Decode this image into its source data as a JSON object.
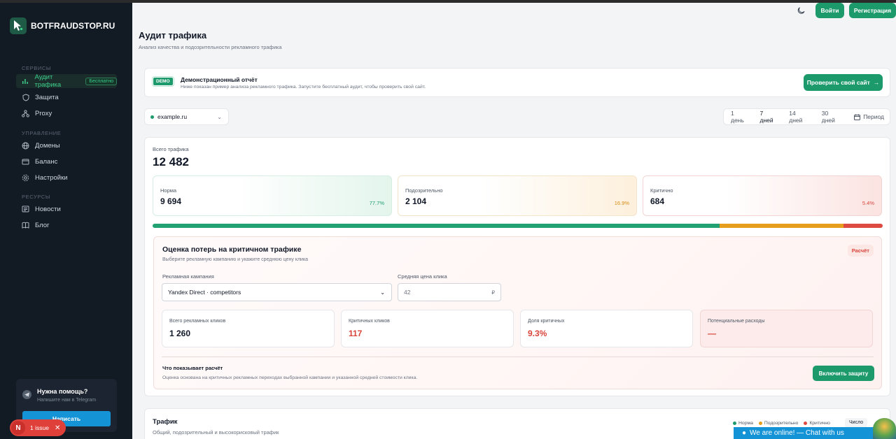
{
  "brand": {
    "name": "BOTFRAUDSTOP.RU"
  },
  "sidebar": {
    "sections": [
      {
        "label": "СЕРВИСЫ"
      },
      {
        "label": "УПРАВЛЕНИЕ"
      },
      {
        "label": "РЕСУРСЫ"
      }
    ],
    "items": [
      {
        "label": "Аудит трафика",
        "badge": "Бесплатно",
        "icon": "chart-bars-icon"
      },
      {
        "label": "Защита",
        "icon": "shield-icon"
      },
      {
        "label": "Proxy",
        "icon": "network-icon"
      },
      {
        "label": "Домены",
        "icon": "globe-icon"
      },
      {
        "label": "Баланс",
        "icon": "wallet-icon"
      },
      {
        "label": "Настройки",
        "icon": "gear-icon"
      },
      {
        "label": "Новости",
        "icon": "newspaper-icon"
      },
      {
        "label": "Блог",
        "icon": "book-icon"
      }
    ],
    "help": {
      "title": "Нужна помощь?",
      "subtitle": "Напишите нам в Telegram",
      "button": "Написать"
    }
  },
  "issues": {
    "letter": "N",
    "label": "1 issue"
  },
  "header": {
    "login": "Войти",
    "register": "Регистрация"
  },
  "page": {
    "title": "Аудит трафика",
    "subtitle": "Анализ качества и подозрительности рекламного трафика"
  },
  "demo": {
    "tag": "DEMO",
    "title": "Демонстрационный отчёт",
    "description": "Ниже показан пример анализа рекламного трафика. Запустите бесплатный аудит, чтобы проверить свой сайт.",
    "button": "Проверить свой сайт"
  },
  "filters": {
    "domain": "example.ru",
    "ranges": [
      "1 день",
      "7 дней",
      "14 дней",
      "30 дней",
      "Период"
    ],
    "active_range": "7 дней"
  },
  "traffic": {
    "total_label": "Всего трафика",
    "total_value": "12 482",
    "norm": {
      "label": "Норма",
      "value": "9 694",
      "pct": "77.7%",
      "fraction": 0.777
    },
    "suspicious": {
      "label": "Подозрительно",
      "value": "2 104",
      "pct": "16.9%",
      "fraction": 0.169
    },
    "critical": {
      "label": "Критично",
      "value": "684",
      "pct": "5.4%",
      "fraction": 0.054
    }
  },
  "loss": {
    "title": "Оценка потерь на критичном трафике",
    "subtitle": "Выберите рекламную кампанию и укажите среднюю цену клика",
    "badge": "Расчёт",
    "campaign_label": "Рекламная кампания",
    "campaign_value": "Yandex Direct · competitors",
    "cpc_label": "Средняя цена клика",
    "cpc_value": "42",
    "cpc_unit": "₽",
    "metrics": [
      {
        "label": "Всего рекламных кликов",
        "value": "1 260"
      },
      {
        "label": "Критичных кликов",
        "value": "117"
      },
      {
        "label": "Доля критичных",
        "value": "9.3%"
      },
      {
        "label": "Потенциальные расходы",
        "value": "—"
      }
    ],
    "what_title": "Что показывает расчёт",
    "what_desc": "Оценка основана на критичных рекламных переходах выбранной кампании и указанной средней стоимости клика.",
    "enable_button": "Включить защиту"
  },
  "chart_section": {
    "title": "Трафик",
    "subtitle": "Общий, подозрительный и высокорисковый трафик",
    "legend": [
      "Норма",
      "Подозрительно",
      "Критично"
    ],
    "mode": "Число"
  },
  "chat": {
    "label": "We are online! — Chat with us"
  },
  "colors": {
    "accent": "#1d9a6c",
    "warning": "#e79e1c",
    "danger": "#dd4a42",
    "sidebar_bg": "#121a24"
  }
}
